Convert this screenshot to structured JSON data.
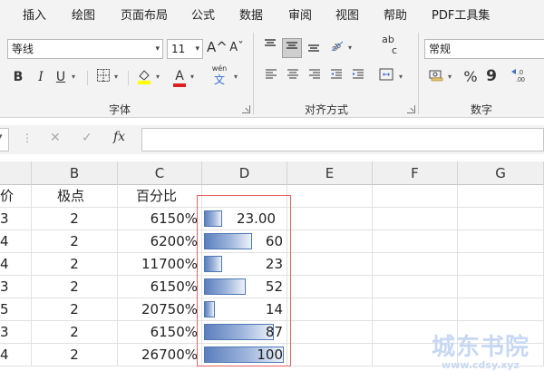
{
  "ribbon": {
    "tabs": [
      "插入",
      "绘图",
      "页面布局",
      "公式",
      "数据",
      "审阅",
      "视图",
      "帮助",
      "PDF工具集"
    ],
    "font": {
      "name": "等线",
      "size": "11",
      "grow_icon": "A^",
      "shrink_icon": "Aˇ",
      "bold": "B",
      "italic": "I",
      "underline": "U",
      "font_color_glyph": "A",
      "phonetic_top": "wén",
      "phonetic_bottom": "文",
      "group_label": "字体"
    },
    "alignment": {
      "group_label": "对齐方式",
      "wrap_glyph": "ab",
      "wrap_glyph2": "c"
    },
    "number": {
      "format": "常规",
      "percent": "%",
      "comma": "9",
      "group_label": "数字"
    },
    "colors": {
      "highlight": "#ffff00",
      "font_color": "#e02020",
      "selection": "#e26060",
      "databar": "#5b7fbd"
    }
  },
  "formula_bar": {
    "cancel_icon": "✕",
    "enter_icon": "✓",
    "fx_label": "fx"
  },
  "grid": {
    "columns": [
      "B",
      "C",
      "D",
      "E",
      "F",
      "G"
    ],
    "header_row": {
      "a": "价",
      "b": "极点",
      "c": "百分比"
    },
    "rows": [
      {
        "a": "3",
        "b": "2",
        "c": "6150%",
        "d": "23.00",
        "bar": 0.23
      },
      {
        "a": "4",
        "b": "2",
        "c": "6200%",
        "d": "60",
        "bar": 0.6
      },
      {
        "a": "4",
        "b": "2",
        "c": "11700%",
        "d": "23",
        "bar": 0.23
      },
      {
        "a": "3",
        "b": "2",
        "c": "6150%",
        "d": "52",
        "bar": 0.52
      },
      {
        "a": "5",
        "b": "2",
        "c": "20750%",
        "d": "14",
        "bar": 0.14
      },
      {
        "a": "3",
        "b": "2",
        "c": "6150%",
        "d": "87",
        "bar": 0.87
      },
      {
        "a": "4",
        "b": "2",
        "c": "26700%",
        "d": "100",
        "bar": 1.0
      }
    ]
  },
  "watermark": {
    "title": "城东书院",
    "url": "www.cdsy.xyz"
  }
}
